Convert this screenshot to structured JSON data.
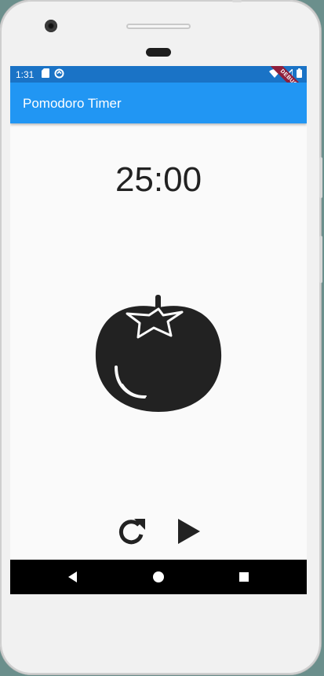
{
  "status_bar": {
    "time": "1:31",
    "left_icons": [
      "sd-card-icon",
      "sync-icon"
    ],
    "right_icons": [
      "wifi-icon",
      "signal-icon",
      "battery-icon"
    ]
  },
  "app_bar": {
    "title": "Pomodoro Timer"
  },
  "debug_banner": {
    "label": "DEBUG"
  },
  "timer": {
    "display": "25:00"
  },
  "main_icon": "tomato-icon",
  "controls": {
    "reset_icon": "refresh-icon",
    "play_icon": "play-icon"
  },
  "nav_bar": {
    "buttons": [
      "back-icon",
      "home-icon",
      "recents-icon"
    ]
  },
  "colors": {
    "app_bar": "#2196f3",
    "status_bar": "#1a73c6",
    "background": "#fafafa",
    "icon": "#222222",
    "debug_banner": "#8f1f3b"
  }
}
